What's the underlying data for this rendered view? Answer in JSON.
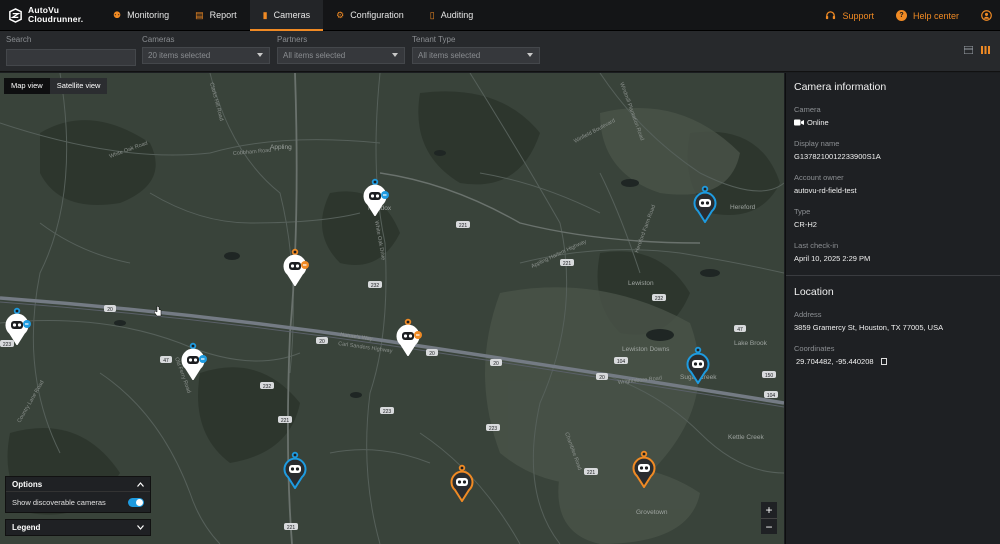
{
  "app": {
    "logo_line1": "AutoVu",
    "logo_line2": "Cloudrunner."
  },
  "nav": {
    "items": [
      {
        "label": "Monitoring",
        "icon": "binoculars-icon",
        "active": false
      },
      {
        "label": "Report",
        "icon": "report-icon",
        "active": false
      },
      {
        "label": "Cameras",
        "icon": "camera-icon",
        "active": true
      },
      {
        "label": "Configuration",
        "icon": "gear-icon",
        "active": false
      },
      {
        "label": "Auditing",
        "icon": "document-icon",
        "active": false
      }
    ],
    "support_label": "Support",
    "help_label": "Help center"
  },
  "filters": {
    "search": {
      "label": "Search",
      "placeholder": ""
    },
    "cameras": {
      "label": "Cameras",
      "value": "20 items selected"
    },
    "partners": {
      "label": "Partners",
      "value": "All items selected"
    },
    "tenant": {
      "label": "Tenant Type",
      "value": "All items selected"
    }
  },
  "map": {
    "map_view_label": "Map view",
    "satellite_view_label": "Satellite view",
    "options_label": "Options",
    "show_discoverable_label": "Show discoverable cameras",
    "show_discoverable": true,
    "legend_label": "Legend",
    "zoom_in": "+",
    "zoom_out": "−",
    "place_labels": [
      "Appling",
      "Maddox",
      "Lewiston",
      "Sugar Creek",
      "Grovetown",
      "Lake Brook",
      "Hereford",
      "Lewiston Downs",
      "Kettle Creek"
    ],
    "road_labels": [
      "Carl Sanders Highway",
      "Nature's Way",
      "Winfield Boulevard",
      "White Oak Road",
      "Hereford Farm Road",
      "Windmill Plantation Road",
      "Cobbham Road",
      "Appling Harlem Highway",
      "White Oak Drive",
      "Chamblee Road",
      "Old Ferry Road",
      "Wrightsboro Road",
      "Country Lane Road",
      "Clarks Hill Road"
    ],
    "route_shields": [
      "20",
      "20",
      "20",
      "20",
      "20",
      "221",
      "221",
      "221",
      "221",
      "221",
      "223",
      "223",
      "223",
      "232",
      "232",
      "47",
      "47",
      "104",
      "104",
      "150",
      "232"
    ],
    "colors": {
      "online": "#1e9be0",
      "warning": "#f08a24",
      "selected": "#ffffff"
    }
  },
  "camera_info": {
    "title": "Camera information",
    "camera_label": "Camera",
    "status": "Online",
    "display_name_label": "Display name",
    "display_name": "G1378210012233900S1A",
    "account_owner_label": "Account owner",
    "account_owner": "autovu-rd-field-test",
    "type_label": "Type",
    "type": "CR-H2",
    "last_checkin_label": "Last check-in",
    "last_checkin": "April 10, 2025 2:29 PM"
  },
  "location": {
    "title": "Location",
    "address_label": "Address",
    "address": "3859 Gramercy St, Houston, TX 77005, USA",
    "coordinates_label": "Coordinates",
    "coordinates": "29.704482, -95.440208"
  }
}
